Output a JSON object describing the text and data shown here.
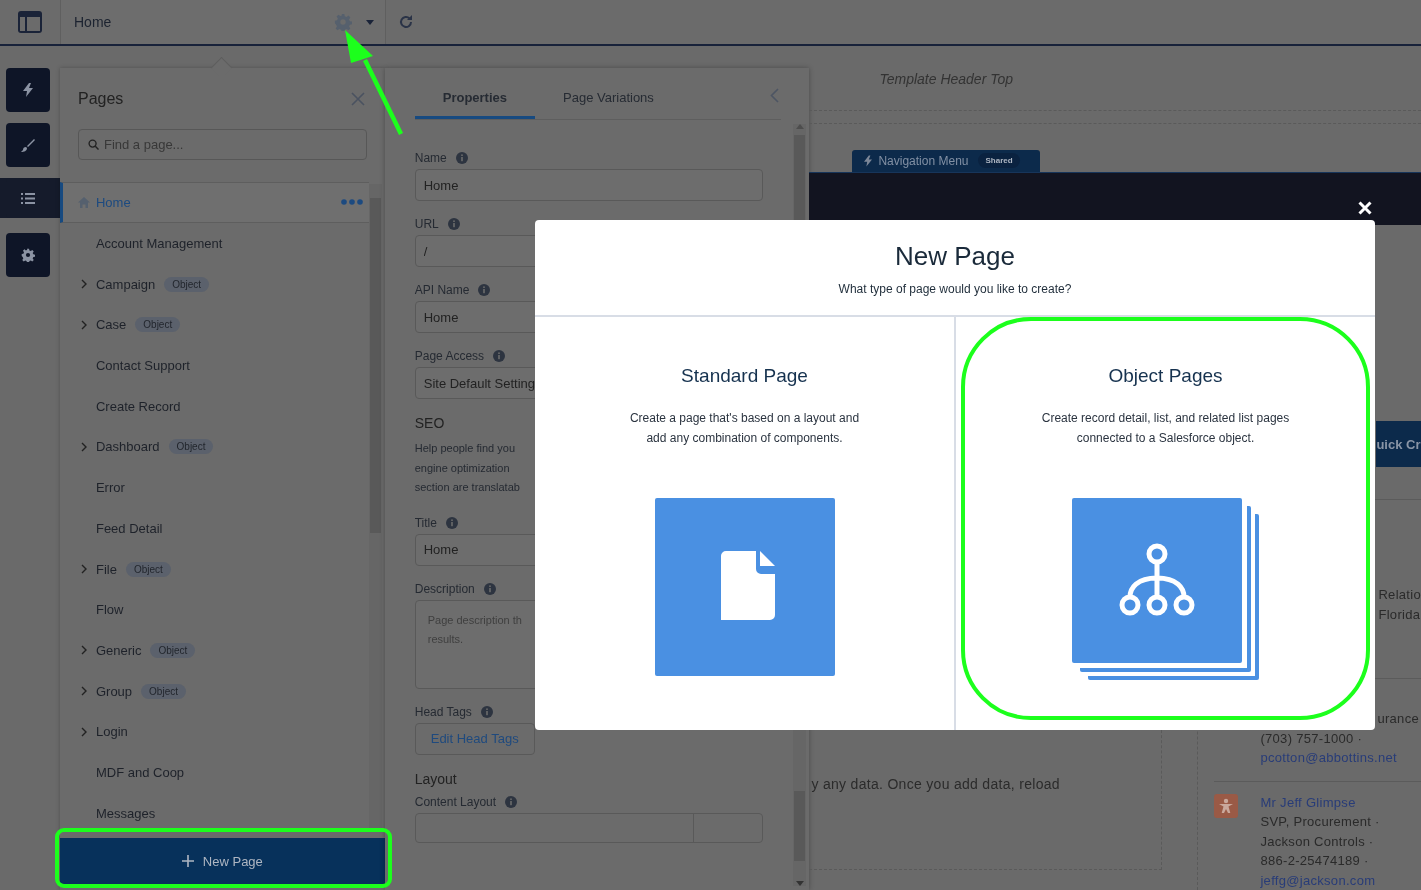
{
  "top_bar": {
    "tab_title": "Home"
  },
  "rail_buttons": [
    {
      "kind": "bolt",
      "selected": false
    },
    {
      "kind": "brush",
      "selected": false
    },
    {
      "kind": "list",
      "selected": true
    },
    {
      "kind": "gear",
      "selected": false
    }
  ],
  "pages_panel": {
    "title": "Pages",
    "search": {
      "placeholder": "Find a page..."
    },
    "items": [
      {
        "label": "Home",
        "kind": "home",
        "selected": true,
        "expandable": false
      },
      {
        "label": "Account Management",
        "kind": "page",
        "selected": false,
        "expandable": false
      },
      {
        "label": "Campaign",
        "kind": "page",
        "selected": false,
        "expandable": true,
        "badge": "Object"
      },
      {
        "label": "Case",
        "kind": "page",
        "selected": false,
        "expandable": true,
        "badge": "Object"
      },
      {
        "label": "Contact Support",
        "kind": "page",
        "selected": false,
        "expandable": false
      },
      {
        "label": "Create Record",
        "kind": "page",
        "selected": false,
        "expandable": false
      },
      {
        "label": "Dashboard",
        "kind": "page",
        "selected": false,
        "expandable": true,
        "badge": "Object"
      },
      {
        "label": "Error",
        "kind": "page",
        "selected": false,
        "expandable": false
      },
      {
        "label": "Feed Detail",
        "kind": "page",
        "selected": false,
        "expandable": false
      },
      {
        "label": "File",
        "kind": "page",
        "selected": false,
        "expandable": true,
        "badge": "Object"
      },
      {
        "label": "Flow",
        "kind": "page",
        "selected": false,
        "expandable": false
      },
      {
        "label": "Generic",
        "kind": "page",
        "selected": false,
        "expandable": true,
        "badge": "Object"
      },
      {
        "label": "Group",
        "kind": "page",
        "selected": false,
        "expandable": true,
        "badge": "Object"
      },
      {
        "label": "Login",
        "kind": "page",
        "selected": false,
        "expandable": true
      },
      {
        "label": "MDF and Coop",
        "kind": "page",
        "selected": false,
        "expandable": false
      },
      {
        "label": "Messages",
        "kind": "page",
        "selected": false,
        "expandable": false
      }
    ],
    "new_page_button": {
      "label": "New Page",
      "highlighted": true
    }
  },
  "properties_panel": {
    "tabs": [
      {
        "label": "Properties",
        "selected": true
      },
      {
        "label": "Page Variations",
        "selected": false
      }
    ],
    "sections": [
      {
        "kind": "input",
        "label": "Name",
        "value": "Home"
      },
      {
        "kind": "input",
        "label": "URL",
        "value": "/"
      },
      {
        "kind": "input",
        "label": "API Name",
        "value": "Home"
      },
      {
        "kind": "input",
        "label": "Page Access",
        "value": "Site Default Setting"
      },
      {
        "kind": "heading",
        "text": "SEO"
      },
      {
        "kind": "paragraph",
        "lines": [
          "Help people find you",
          "engine optimization",
          "section are translatab"
        ]
      },
      {
        "kind": "input",
        "label": "Title",
        "value": "Home"
      },
      {
        "kind": "textarea",
        "label": "Description",
        "placeholder": "Page description th\nresults."
      },
      {
        "kind": "button",
        "label": "Head Tags",
        "text": "Edit Head Tags"
      },
      {
        "kind": "heading",
        "text": "Layout"
      },
      {
        "kind": "select",
        "label": "Content Layout"
      }
    ]
  },
  "canvas": {
    "header_label": "Template Header Top",
    "nav_tab": {
      "label": "Navigation Menu",
      "badge": "Shared"
    },
    "quick_button": "uick Cr",
    "empty_text": "y any data. Once you add data, reload",
    "contacts": [
      {
        "kind": "partial",
        "lines": [
          {
            "text": "Relatio",
            "kind": "cut"
          },
          {
            "text": "Florida",
            "kind": "cut"
          }
        ]
      },
      {
        "kind": "partial",
        "lines": [
          {
            "text": "urance",
            "kind": "cut"
          },
          {
            "text": "(703) 757-1000 ·",
            "kind": "detail"
          },
          {
            "text": "pcotton@abbottins.net",
            "kind": "link"
          }
        ]
      },
      {
        "kind": "person",
        "lines": [
          {
            "text": "Mr Jeff Glimpse",
            "kind": "link"
          },
          {
            "text": "SVP, Procurement ·",
            "kind": "detail"
          },
          {
            "text": "Jackson Controls ·",
            "kind": "detail"
          },
          {
            "text": "886-2-25474189 ·",
            "kind": "detail"
          },
          {
            "text": "jeffg@jackson.com",
            "kind": "link"
          }
        ]
      }
    ]
  },
  "modal": {
    "title": "New Page",
    "subtitle": "What type of page would you like to create?",
    "options": [
      {
        "kind": "standard",
        "title": "Standard Page",
        "lines": [
          "Create a page that's based on a layout and",
          "add any combination of components."
        ],
        "highlighted": false
      },
      {
        "kind": "object",
        "title": "Object Pages",
        "lines": [
          "Create record detail, list, and related list pages",
          "connected to a Salesforce object."
        ],
        "highlighted": true
      }
    ]
  }
}
